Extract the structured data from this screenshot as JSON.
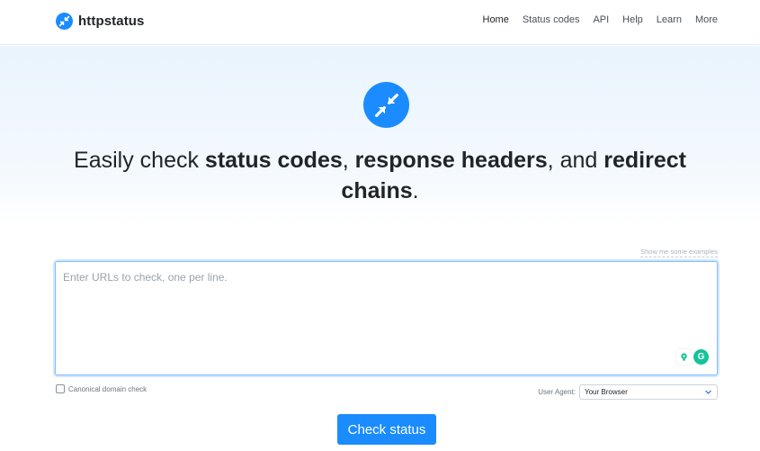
{
  "brand": {
    "name": "httpstatus"
  },
  "nav": {
    "items": [
      {
        "label": "Home",
        "active": true
      },
      {
        "label": "Status codes",
        "active": false
      },
      {
        "label": "API",
        "active": false
      },
      {
        "label": "Help",
        "active": false
      },
      {
        "label": "Learn",
        "active": false
      },
      {
        "label": "More",
        "active": false
      }
    ]
  },
  "hero": {
    "headline": {
      "prefix": "Easily check ",
      "bold1": "status codes",
      "sep1": ", ",
      "bold2": "response headers",
      "sep2": ", and ",
      "bold3": "redirect chains",
      "suffix": "."
    }
  },
  "checker": {
    "examples_link": "Show me some examples",
    "url_placeholder": "Enter URLs to check, one per line.",
    "canonical_label": "Canonical domain check",
    "canonical_checked": false,
    "user_agent_label": "User Agent:",
    "user_agent_value": "Your Browser",
    "submit_label": "Check status"
  },
  "colors": {
    "accent": "#1a8cff",
    "extension": "#15c39a"
  },
  "icons": {
    "brand": "arrows-in-out-icon",
    "hero": "arrows-in-out-icon",
    "select": "chevron-down-icon"
  }
}
